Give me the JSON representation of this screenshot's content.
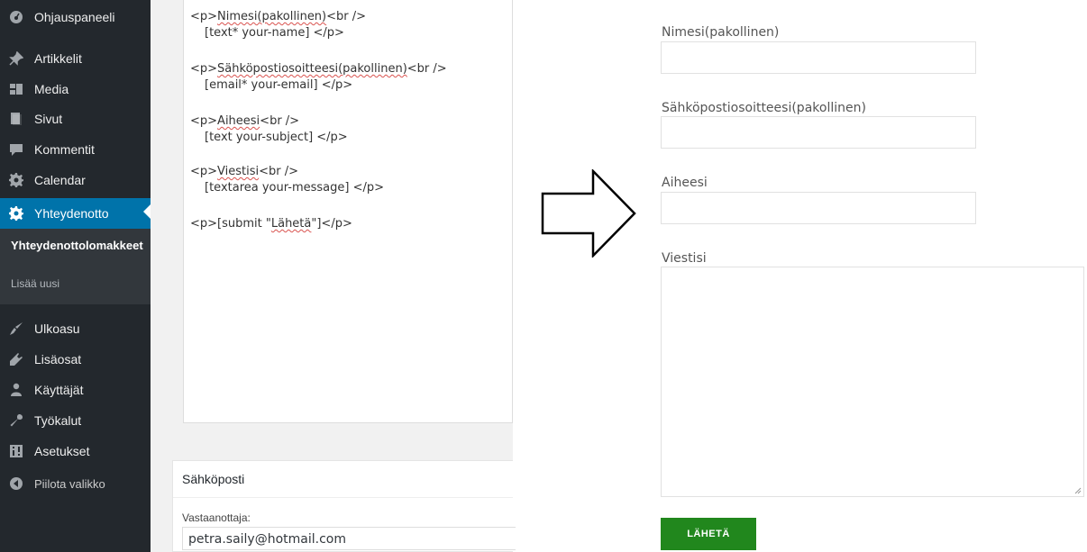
{
  "sidebar": {
    "items": [
      {
        "label": "Ohjauspaneeli",
        "icon": "dashboard-icon"
      },
      {
        "label": "Artikkelit",
        "icon": "pin-icon"
      },
      {
        "label": "Media",
        "icon": "media-icon"
      },
      {
        "label": "Sivut",
        "icon": "pages-icon"
      },
      {
        "label": "Kommentit",
        "icon": "comment-icon"
      },
      {
        "label": "Calendar",
        "icon": "gear-icon"
      },
      {
        "label": "Yhteydenotto",
        "icon": "gear-icon"
      },
      {
        "label": "Ulkoasu",
        "icon": "brush-icon"
      },
      {
        "label": "Lisäosat",
        "icon": "plugin-icon"
      },
      {
        "label": "Käyttäjät",
        "icon": "users-icon"
      },
      {
        "label": "Työkalut",
        "icon": "wrench-icon"
      },
      {
        "label": "Asetukset",
        "icon": "settings-icon"
      }
    ],
    "submenu": {
      "current": "Yhteydenottolomakkeet",
      "add_new": "Lisää uusi"
    },
    "collapse_label": "Piilota valikko",
    "active_color": "#0073aa"
  },
  "editor": {
    "fields": [
      {
        "p_open": "<p>",
        "label": "Nimesi(pakollinen)",
        "br": "<br />",
        "tag": "[text* your-name] </p>"
      },
      {
        "p_open": "<p>",
        "label": "Sähköpostiosoitteesi(pakollinen)",
        "br": "<br />",
        "tag": "[email* your-email] </p>"
      },
      {
        "p_open": "<p>",
        "label": "Aiheesi",
        "br": "<br />",
        "tag": "[text your-subject] </p>"
      },
      {
        "p_open": "<p>",
        "label": "Viestisi",
        "br": "<br />",
        "tag": "[textarea your-message] </p>"
      }
    ],
    "submit_line": {
      "before": "<p>[submit \"",
      "word": "Lähetä",
      "after": "\"]</p>"
    }
  },
  "mail": {
    "title": "Sähköposti",
    "recipient_label": "Vastaanottaja:",
    "recipient_value": "petra.saily@hotmail.com"
  },
  "preview": {
    "labels": [
      "Nimesi(pakollinen)",
      "Sähköpostiosoitteesi(pakollinen)",
      "Aiheesi",
      "Viestisi"
    ],
    "submit_label": "LÄHETÄ",
    "submit_color": "#21871d"
  }
}
